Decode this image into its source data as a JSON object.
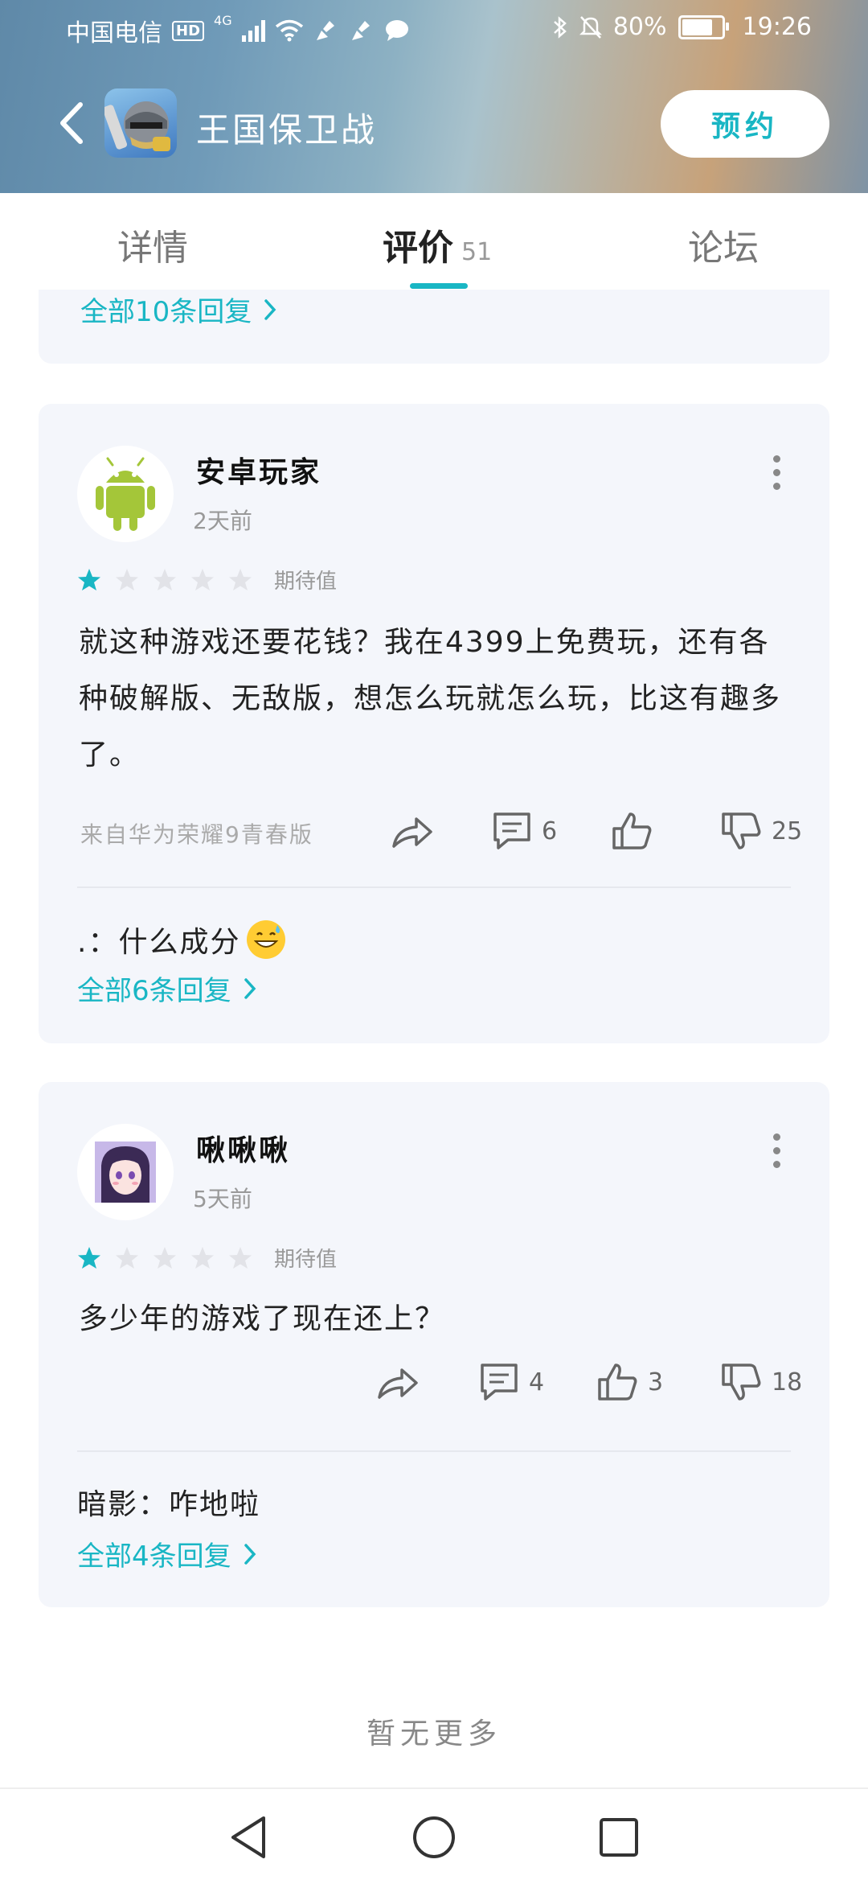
{
  "status_bar": {
    "carrier": "中国电信",
    "hd": "HD",
    "network": "4G",
    "battery": "80%",
    "battery_level": 0.8,
    "time": "19:26"
  },
  "app_bar": {
    "title": "王国保卫战",
    "reserve_label": "预约"
  },
  "tabs": [
    {
      "label": "详情"
    },
    {
      "label": "评价",
      "count": "51"
    },
    {
      "label": "论坛"
    }
  ],
  "partial_card": {
    "replies_link": "全部10条回复"
  },
  "reviews": [
    {
      "username": "安卓玩家",
      "time": "2天前",
      "rating": 1,
      "rating_max": 5,
      "rating_label": "期待值",
      "content": "就这种游戏还要花钱？我在4399上免费玩，还有各种破解版、无敌版，想怎么玩就怎么玩，比这有趣多了。",
      "device": "来自华为荣耀9青春版",
      "comments": "6",
      "likes": "",
      "dislikes": "25",
      "reply_preview": ".：什么成分",
      "replies_link": "全部6条回复"
    },
    {
      "username": "啾啾啾",
      "time": "5天前",
      "rating": 1,
      "rating_max": 5,
      "rating_label": "期待值",
      "content": "多少年的游戏了现在还上？",
      "device": "",
      "comments": "4",
      "likes": "3",
      "dislikes": "18",
      "reply_preview": "暗影：咋地啦",
      "replies_link": "全部4条回复"
    }
  ],
  "footer_text": "暂无更多",
  "colors": {
    "accent": "#19b6c4",
    "card_bg": "#f4f6fb",
    "android_green": "#a4c639"
  }
}
